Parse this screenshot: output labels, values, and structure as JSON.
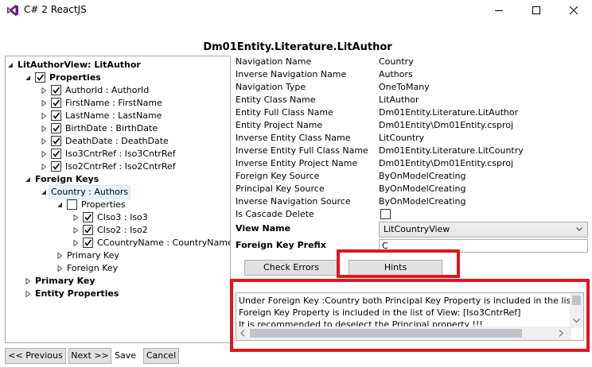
{
  "window": {
    "title": "C# 2 ReactJS",
    "brand_color": "#68217a"
  },
  "heading": "Dm01Entity.Literature.LitAuthor",
  "tree": {
    "root": "LitAuthorView: LitAuthor",
    "properties": "Properties",
    "prop_items": [
      "AuthorId : AuthorId",
      "FirstName : FirstName",
      "LastName : LastName",
      "BirthDate : BirthDate",
      "DeathDate : DeathDate",
      "Iso3CntrRef : Iso3CntrRef",
      "Iso2CntrRef : Iso2CntrRef"
    ],
    "foreign_keys": "Foreign Keys",
    "country_authors": "Country : Authors",
    "fk_properties": "Properties",
    "fk_prop_items": [
      "CIso3 : Iso3",
      "CIso2 : Iso2",
      "CCountryName : CountryName"
    ],
    "fk_primary_key": "Primary Key",
    "fk_foreign_key": "Foreign Key",
    "primary_key": "Primary Key",
    "entity_properties": "Entity Properties"
  },
  "props": [
    {
      "key": "Navigation Name",
      "value": "Country"
    },
    {
      "key": "Inverse Navigation Name",
      "value": "Authors"
    },
    {
      "key": "Navigation Type",
      "value": "OneToMany"
    },
    {
      "key": "Entity Class Name",
      "value": "LitAuthor"
    },
    {
      "key": "Entity Full Class Name",
      "value": "Dm01Entity.Literature.LitAuthor"
    },
    {
      "key": "Entity Project Name",
      "value": "Dm01Entity\\Dm01Entity.csproj"
    },
    {
      "key": "Inverse Entity Class Name",
      "value": "LitCountry"
    },
    {
      "key": "Inverse Entity Full Class Name",
      "value": "Dm01Entity.Literature.LitCountry"
    },
    {
      "key": "Inverse Entity Project Name",
      "value": "Dm01Entity\\Dm01Entity.csproj"
    },
    {
      "key": "Foreign Key Source",
      "value": "ByOnModelCreating"
    },
    {
      "key": "Principal Key Source",
      "value": "ByOnModelCreating"
    },
    {
      "key": "Inverse Navigation Source",
      "value": "ByOnModelCreating"
    }
  ],
  "cascade_delete_label": "Is Cascade Delete",
  "view_name_label": "View Name",
  "view_name_value": "LitCountryView",
  "fk_prefix_label": "Foreign Key Prefix",
  "fk_prefix_value": "C",
  "buttons": {
    "check_errors": "Check Errors",
    "hints": "Hints",
    "previous": "<< Previous",
    "next": "Next >>",
    "save": "Save",
    "cancel": "Cancel"
  },
  "messages": [
    "Under Foreign Key :Country  both Principal Key Property is included in the list c",
    "Foreign Key Property is included in the list of View: [Iso3CntrRef]",
    "It is recommended to deselect the Principal property !!!"
  ],
  "highlight_color": "#e3141e"
}
